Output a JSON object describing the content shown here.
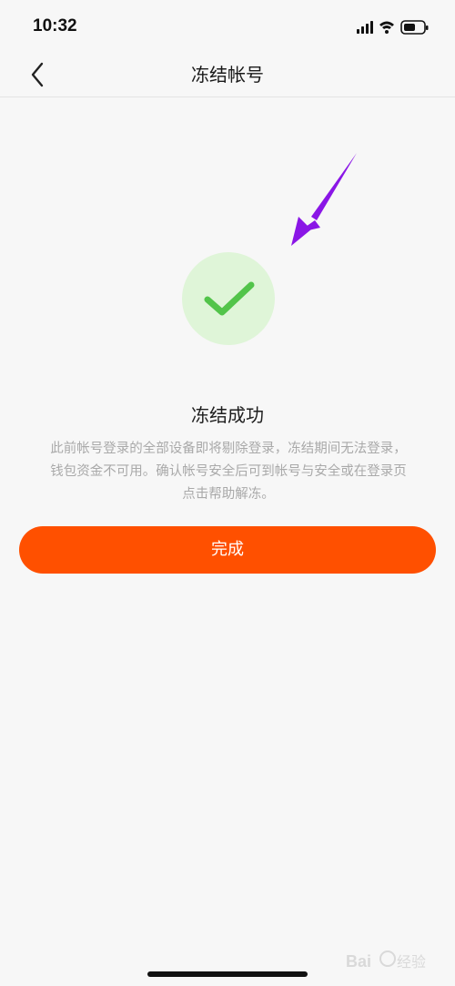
{
  "status_bar": {
    "time": "10:32",
    "icons": [
      "signal-icon",
      "wifi-icon",
      "battery-icon"
    ]
  },
  "nav": {
    "back_icon": "chevron-left-icon",
    "title": "冻结帐号"
  },
  "result": {
    "icon": "check-icon",
    "title": "冻结成功",
    "description": "此前帐号登录的全部设备即将剔除登录，冻结期间无法登录，钱包资金不可用。确认帐号安全后可到帐号与安全或在登录页点击帮助解冻。"
  },
  "actions": {
    "done_label": "完成"
  },
  "colors": {
    "accent": "#ff5000",
    "success": "#52c44a",
    "success_bg": "#dff5d8",
    "annotation": "#8a16e6"
  },
  "watermark": {
    "text": "Bai 经验"
  }
}
